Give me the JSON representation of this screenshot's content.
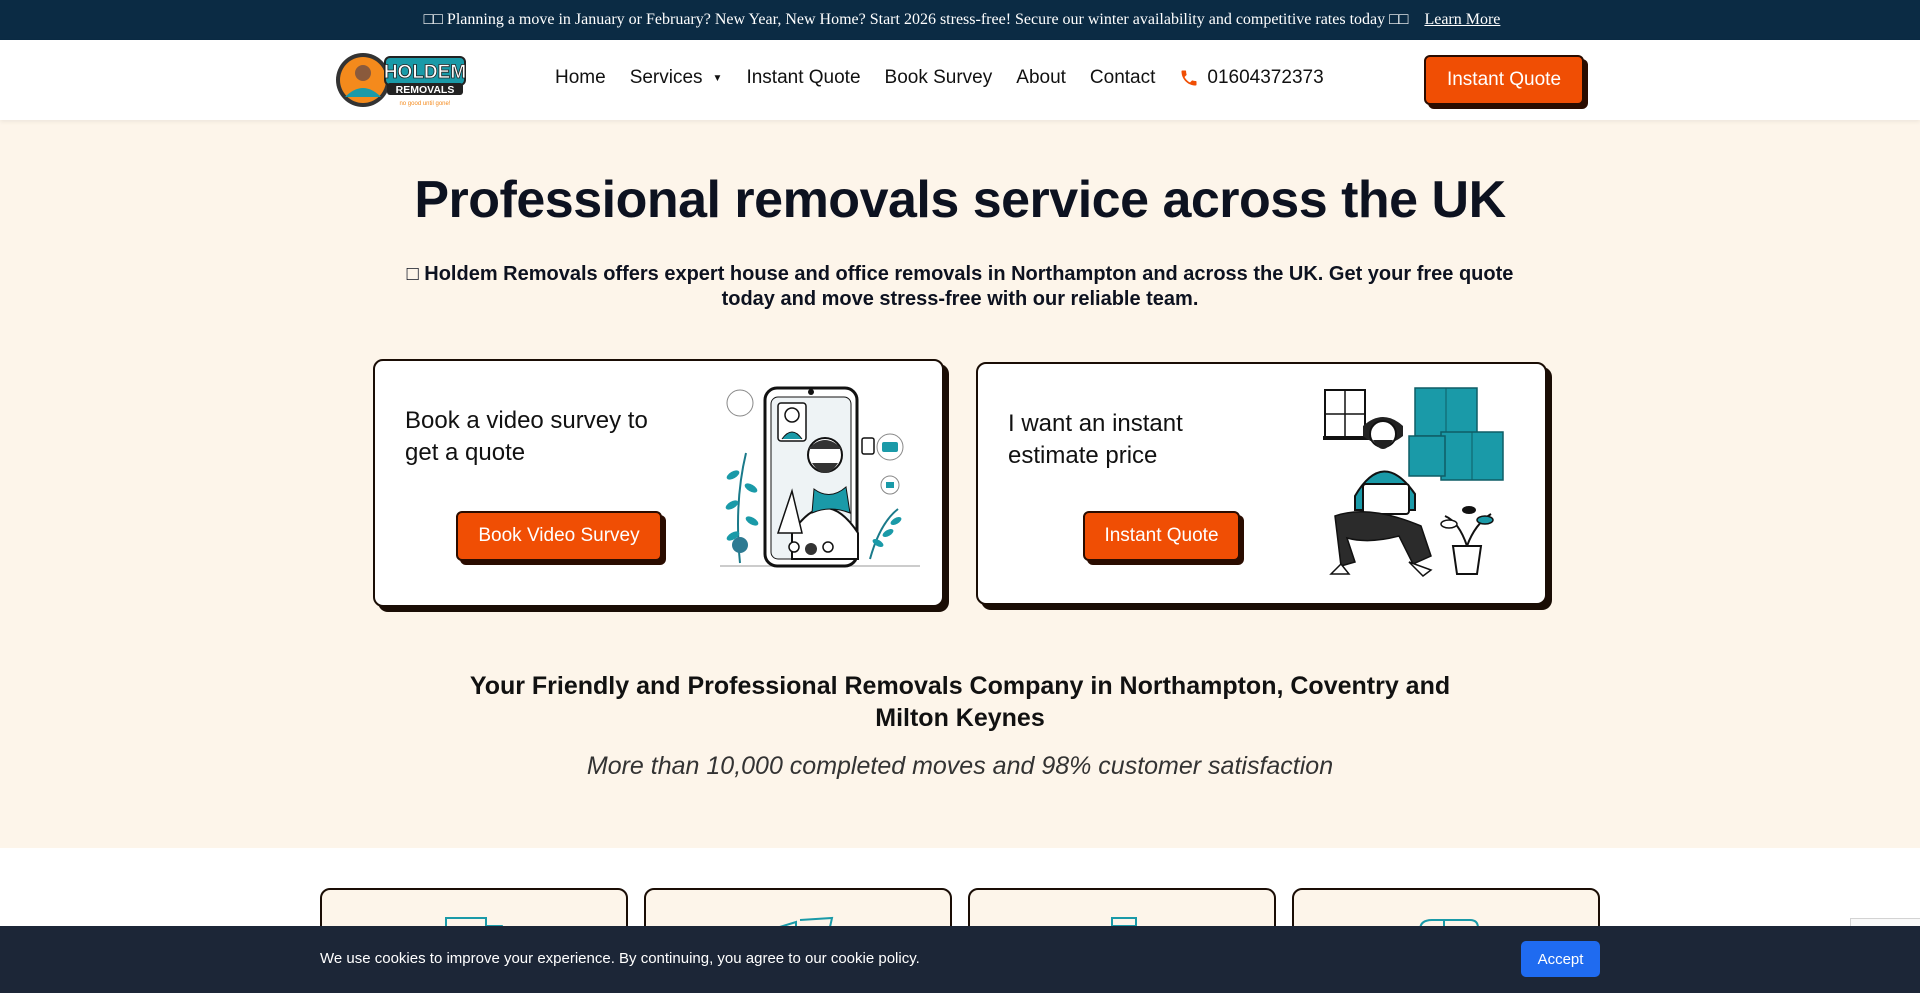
{
  "announcement": {
    "prefix_glyph": "□□",
    "text": "Planning a move in January or February? New Year, New Home? Start 2026 stress-free! Secure our winter availability and competitive rates today",
    "suffix_glyph": "□□",
    "link": "Learn More"
  },
  "header": {
    "logo_text": "HOLDEM",
    "logo_sub": "REMOVALS",
    "logo_tagline": "no good until gone!",
    "nav": [
      "Home",
      "Services",
      "Instant Quote",
      "Book Survey",
      "About",
      "Contact"
    ],
    "phone": "01604372373",
    "cta": "Instant Quote"
  },
  "hero": {
    "title": "Professional removals service across the UK",
    "subtitle_glyph": "□",
    "subtitle": "Holdem Removals offers expert house and office removals in Northampton and across the UK. Get your free quote today and move stress-free with our reliable team."
  },
  "cards": [
    {
      "title": "Book a video survey to get a quote",
      "button": "Book Video Survey"
    },
    {
      "title": "I want an instant estimate price",
      "button": "Instant Quote"
    }
  ],
  "section": {
    "title": "Your Friendly and Professional Removals Company in Northampton, Coventry and Milton Keynes",
    "subtitle": "More than 10,000 completed moves and 98% customer satisfaction"
  },
  "cookie": {
    "message": "We use cookies to improve your experience. By continuing, you agree to our cookie policy.",
    "accept": "Accept"
  },
  "colors": {
    "accent": "#f04e04",
    "topbar": "#0b2b44",
    "hero_bg": "#fdf5ea",
    "teal": "#1a9aa8",
    "cookie_bg": "#1c2637",
    "accept": "#1f6bf0"
  },
  "icons": [
    "phone-icon",
    "caret-down-icon",
    "truck-icon",
    "boxes-icon",
    "calendar-icon",
    "van-icon"
  ]
}
